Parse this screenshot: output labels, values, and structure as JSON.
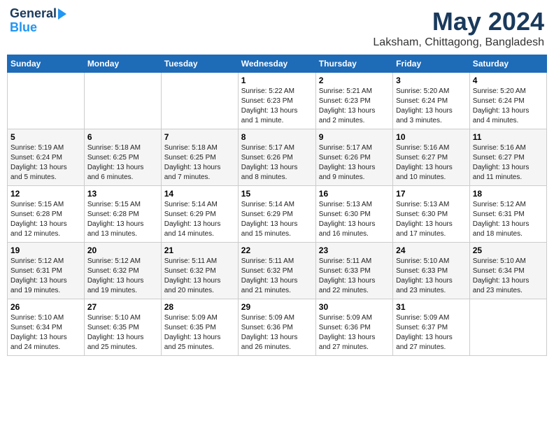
{
  "logo": {
    "line1": "General",
    "line2": "Blue"
  },
  "title": "May 2024",
  "location": "Laksham, Chittagong, Bangladesh",
  "headers": [
    "Sunday",
    "Monday",
    "Tuesday",
    "Wednesday",
    "Thursday",
    "Friday",
    "Saturday"
  ],
  "weeks": [
    [
      {
        "day": "",
        "info": ""
      },
      {
        "day": "",
        "info": ""
      },
      {
        "day": "",
        "info": ""
      },
      {
        "day": "1",
        "info": "Sunrise: 5:22 AM\nSunset: 6:23 PM\nDaylight: 13 hours\nand 1 minute."
      },
      {
        "day": "2",
        "info": "Sunrise: 5:21 AM\nSunset: 6:23 PM\nDaylight: 13 hours\nand 2 minutes."
      },
      {
        "day": "3",
        "info": "Sunrise: 5:20 AM\nSunset: 6:24 PM\nDaylight: 13 hours\nand 3 minutes."
      },
      {
        "day": "4",
        "info": "Sunrise: 5:20 AM\nSunset: 6:24 PM\nDaylight: 13 hours\nand 4 minutes."
      }
    ],
    [
      {
        "day": "5",
        "info": "Sunrise: 5:19 AM\nSunset: 6:24 PM\nDaylight: 13 hours\nand 5 minutes."
      },
      {
        "day": "6",
        "info": "Sunrise: 5:18 AM\nSunset: 6:25 PM\nDaylight: 13 hours\nand 6 minutes."
      },
      {
        "day": "7",
        "info": "Sunrise: 5:18 AM\nSunset: 6:25 PM\nDaylight: 13 hours\nand 7 minutes."
      },
      {
        "day": "8",
        "info": "Sunrise: 5:17 AM\nSunset: 6:26 PM\nDaylight: 13 hours\nand 8 minutes."
      },
      {
        "day": "9",
        "info": "Sunrise: 5:17 AM\nSunset: 6:26 PM\nDaylight: 13 hours\nand 9 minutes."
      },
      {
        "day": "10",
        "info": "Sunrise: 5:16 AM\nSunset: 6:27 PM\nDaylight: 13 hours\nand 10 minutes."
      },
      {
        "day": "11",
        "info": "Sunrise: 5:16 AM\nSunset: 6:27 PM\nDaylight: 13 hours\nand 11 minutes."
      }
    ],
    [
      {
        "day": "12",
        "info": "Sunrise: 5:15 AM\nSunset: 6:28 PM\nDaylight: 13 hours\nand 12 minutes."
      },
      {
        "day": "13",
        "info": "Sunrise: 5:15 AM\nSunset: 6:28 PM\nDaylight: 13 hours\nand 13 minutes."
      },
      {
        "day": "14",
        "info": "Sunrise: 5:14 AM\nSunset: 6:29 PM\nDaylight: 13 hours\nand 14 minutes."
      },
      {
        "day": "15",
        "info": "Sunrise: 5:14 AM\nSunset: 6:29 PM\nDaylight: 13 hours\nand 15 minutes."
      },
      {
        "day": "16",
        "info": "Sunrise: 5:13 AM\nSunset: 6:30 PM\nDaylight: 13 hours\nand 16 minutes."
      },
      {
        "day": "17",
        "info": "Sunrise: 5:13 AM\nSunset: 6:30 PM\nDaylight: 13 hours\nand 17 minutes."
      },
      {
        "day": "18",
        "info": "Sunrise: 5:12 AM\nSunset: 6:31 PM\nDaylight: 13 hours\nand 18 minutes."
      }
    ],
    [
      {
        "day": "19",
        "info": "Sunrise: 5:12 AM\nSunset: 6:31 PM\nDaylight: 13 hours\nand 19 minutes."
      },
      {
        "day": "20",
        "info": "Sunrise: 5:12 AM\nSunset: 6:32 PM\nDaylight: 13 hours\nand 19 minutes."
      },
      {
        "day": "21",
        "info": "Sunrise: 5:11 AM\nSunset: 6:32 PM\nDaylight: 13 hours\nand 20 minutes."
      },
      {
        "day": "22",
        "info": "Sunrise: 5:11 AM\nSunset: 6:32 PM\nDaylight: 13 hours\nand 21 minutes."
      },
      {
        "day": "23",
        "info": "Sunrise: 5:11 AM\nSunset: 6:33 PM\nDaylight: 13 hours\nand 22 minutes."
      },
      {
        "day": "24",
        "info": "Sunrise: 5:10 AM\nSunset: 6:33 PM\nDaylight: 13 hours\nand 23 minutes."
      },
      {
        "day": "25",
        "info": "Sunrise: 5:10 AM\nSunset: 6:34 PM\nDaylight: 13 hours\nand 23 minutes."
      }
    ],
    [
      {
        "day": "26",
        "info": "Sunrise: 5:10 AM\nSunset: 6:34 PM\nDaylight: 13 hours\nand 24 minutes."
      },
      {
        "day": "27",
        "info": "Sunrise: 5:10 AM\nSunset: 6:35 PM\nDaylight: 13 hours\nand 25 minutes."
      },
      {
        "day": "28",
        "info": "Sunrise: 5:09 AM\nSunset: 6:35 PM\nDaylight: 13 hours\nand 25 minutes."
      },
      {
        "day": "29",
        "info": "Sunrise: 5:09 AM\nSunset: 6:36 PM\nDaylight: 13 hours\nand 26 minutes."
      },
      {
        "day": "30",
        "info": "Sunrise: 5:09 AM\nSunset: 6:36 PM\nDaylight: 13 hours\nand 27 minutes."
      },
      {
        "day": "31",
        "info": "Sunrise: 5:09 AM\nSunset: 6:37 PM\nDaylight: 13 hours\nand 27 minutes."
      },
      {
        "day": "",
        "info": ""
      }
    ]
  ]
}
